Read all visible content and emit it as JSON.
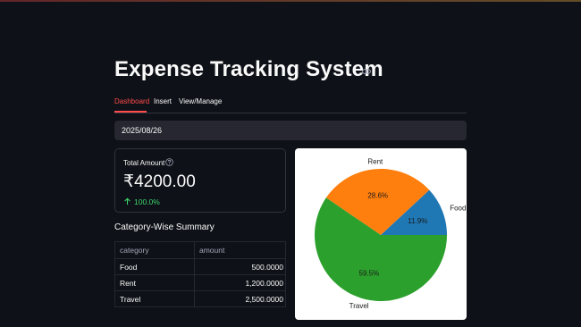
{
  "app": {
    "title": "Expense Tracking System",
    "link_icon": "link-icon"
  },
  "tabs": [
    {
      "label": "Dashboard",
      "active": true
    },
    {
      "label": "Insert",
      "active": false
    },
    {
      "label": "View/Manage",
      "active": false
    }
  ],
  "date_input": {
    "value": "2025/08/26"
  },
  "metric": {
    "label": "Total Amount",
    "help_icon": "question-circle-icon",
    "value": "₹4200.00",
    "delta": "100.0%",
    "delta_icon": "arrow-up-icon",
    "delta_color": "#3dd56d"
  },
  "summary": {
    "title": "Category-Wise Summary",
    "columns": [
      "category",
      "amount"
    ],
    "rows": [
      {
        "category": "Food",
        "amount": "500.0000"
      },
      {
        "category": "Rent",
        "amount": "1,200.0000"
      },
      {
        "category": "Travel",
        "amount": "2,500.0000"
      }
    ]
  },
  "chart_data": {
    "type": "pie",
    "categories": [
      "Food",
      "Rent",
      "Travel"
    ],
    "values": [
      500,
      1200,
      2500
    ],
    "percent_labels": [
      "11.9%",
      "28.6%",
      "59.5%"
    ],
    "colors": [
      "#1f77b4",
      "#ff7f0e",
      "#2ca02c"
    ]
  },
  "colors": {
    "accent": "#ff4b4b",
    "background": "#0e1117",
    "panel": "#262730"
  }
}
